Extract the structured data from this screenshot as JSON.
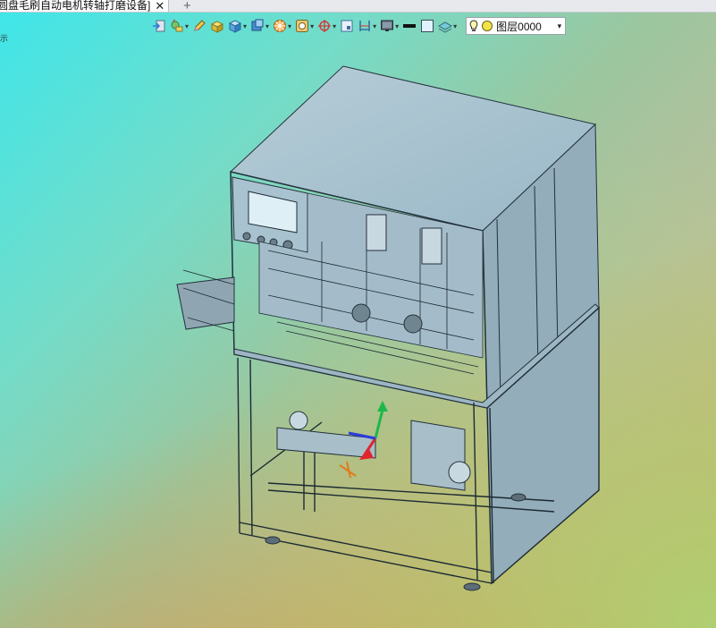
{
  "tab": {
    "title": "圆盘毛刷自动电机转轴打磨设备]",
    "close_glyph": "✕",
    "add_glyph": "+"
  },
  "toolbar": {
    "buttons": [
      {
        "icon": "import-icon",
        "dropdown": false
      },
      {
        "icon": "render-style-icon",
        "dropdown": true
      },
      {
        "icon": "pencil-icon",
        "dropdown": false
      },
      {
        "icon": "box-icon",
        "dropdown": false
      },
      {
        "icon": "cube-icon",
        "dropdown": true
      },
      {
        "icon": "view-cube-icon",
        "dropdown": true
      },
      {
        "icon": "section-icon",
        "dropdown": true
      },
      {
        "icon": "snap-icon",
        "dropdown": true
      },
      {
        "icon": "crosshair-icon",
        "dropdown": true
      },
      {
        "icon": "frame-icon",
        "dropdown": false
      },
      {
        "icon": "dimension-icon",
        "dropdown": true
      },
      {
        "icon": "monitor-icon",
        "dropdown": true
      },
      {
        "icon": "black-line-icon",
        "dropdown": false
      },
      {
        "icon": "white-square-icon",
        "dropdown": false
      },
      {
        "icon": "layer-stack-icon",
        "dropdown": true
      }
    ],
    "caret_glyph": "▾",
    "layer_select": {
      "value": "图层0000",
      "caret": "▾"
    }
  },
  "side_mark": "示"
}
